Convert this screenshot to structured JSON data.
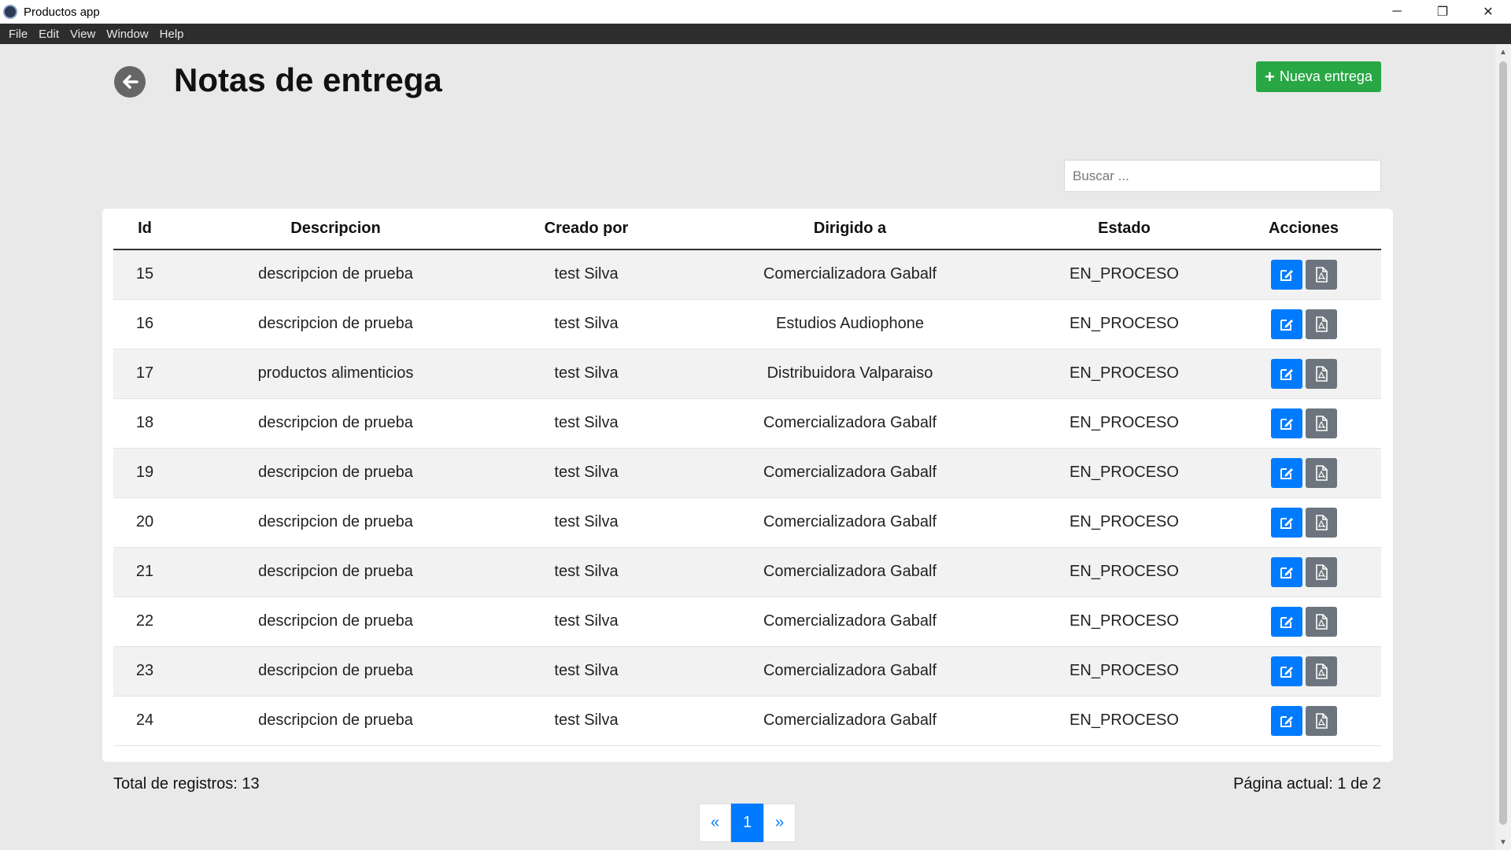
{
  "window": {
    "title": "Productos app",
    "controls": [
      "─",
      "❐",
      "✕"
    ]
  },
  "menu": [
    "File",
    "Edit",
    "View",
    "Window",
    "Help"
  ],
  "header": {
    "title": "Notas de entrega",
    "new_button_label": "Nueva entrega",
    "back_icon": "arrow-left-circle-icon"
  },
  "search": {
    "placeholder": "Buscar ...",
    "value": ""
  },
  "table": {
    "columns": [
      "Id",
      "Descripcion",
      "Creado por",
      "Dirigido a",
      "Estado",
      "Acciones"
    ],
    "rows": [
      [
        "15",
        "descripcion de prueba",
        "test Silva",
        "Comercializadora Gabalf",
        "EN_PROCESO"
      ],
      [
        "16",
        "descripcion de prueba",
        "test Silva",
        "Estudios Audiophone",
        "EN_PROCESO"
      ],
      [
        "17",
        "productos alimenticios",
        "test Silva",
        "Distribuidora Valparaiso",
        "EN_PROCESO"
      ],
      [
        "18",
        "descripcion de prueba",
        "test Silva",
        "Comercializadora Gabalf",
        "EN_PROCESO"
      ],
      [
        "19",
        "descripcion de prueba",
        "test Silva",
        "Comercializadora Gabalf",
        "EN_PROCESO"
      ],
      [
        "20",
        "descripcion de prueba",
        "test Silva",
        "Comercializadora Gabalf",
        "EN_PROCESO"
      ],
      [
        "21",
        "descripcion de prueba",
        "test Silva",
        "Comercializadora Gabalf",
        "EN_PROCESO"
      ],
      [
        "22",
        "descripcion de prueba",
        "test Silva",
        "Comercializadora Gabalf",
        "EN_PROCESO"
      ],
      [
        "23",
        "descripcion de prueba",
        "test Silva",
        "Comercializadora Gabalf",
        "EN_PROCESO"
      ],
      [
        "24",
        "descripcion de prueba",
        "test Silva",
        "Comercializadora Gabalf",
        "EN_PROCESO"
      ]
    ],
    "action_icons": [
      "edit-icon",
      "pdf-file-icon"
    ]
  },
  "footer": {
    "total": "Total de registros: 13",
    "page_info": "Página actual: 1 de 2"
  },
  "pagination": {
    "prev": "«",
    "current": "1",
    "next": "»"
  },
  "colors": {
    "primary": "#007bff",
    "success": "#28a745",
    "secondary": "#6c757d",
    "background": "#e9e9e9"
  }
}
